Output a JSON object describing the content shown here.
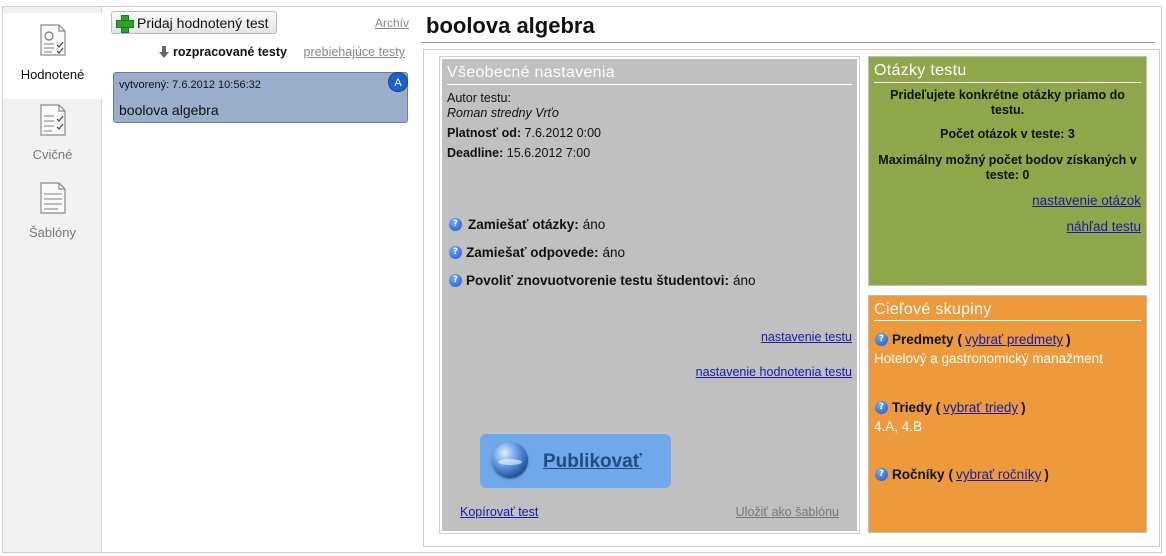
{
  "nav": {
    "items": [
      {
        "label": "Hodnotené",
        "icon": "graded-tests-icon"
      },
      {
        "label": "Cvičné",
        "icon": "practice-tests-icon"
      },
      {
        "label": "Šablóny",
        "icon": "templates-icon"
      }
    ]
  },
  "list": {
    "add_button": "Pridaj hodnotený test",
    "archive_link": "Archív",
    "filter_active": "rozpracované testy",
    "filter_other": "prebiehajúce testy",
    "card": {
      "created": "vytvorený: 7.6.2012 10:56:32",
      "title": "boolova algebra",
      "badge": "A"
    }
  },
  "main": {
    "title": "boolova algebra",
    "general": {
      "heading": "Všeobecné nastavenia",
      "author_label": "Autor testu:",
      "author_value": "Roman stredny Vrťo",
      "valid_from_label": "Platnosť od:",
      "valid_from_value": "7.6.2012 0:00",
      "deadline_label": "Deadline:",
      "deadline_value": "15.6.2012 7:00",
      "options": [
        {
          "label": "Zamiešať otázky:",
          "value": "áno"
        },
        {
          "label": "Zamiešať odpovede:",
          "value": "áno"
        },
        {
          "label": "Povoliť znovuotvorenie testu študentovi:",
          "value": "áno"
        }
      ],
      "settings_link": "nastavenie testu",
      "grading_link": "nastavenie hodnotenia testu",
      "publish_label": "Publikovať",
      "copy_link": "Kopírovať test",
      "save_template_link": "Uložiť ako šablónu"
    },
    "questions": {
      "heading": "Otázky testu",
      "info": "Prideľujete konkrétne otázky priamo do testu.",
      "count": "Počet otázok v teste: 3",
      "max_points": "Maximálny možný počet bodov získaných v teste: 0",
      "settings_link": "nastavenie otázok",
      "preview_link": "náhľad testu"
    },
    "groups": {
      "heading": "Cieľové skupiny",
      "subjects_label": "Predmety",
      "subjects_link": "vybrať predmety",
      "subjects_value": "Hotelový a gastronomický manažment",
      "classes_label": "Triedy",
      "classes_link": "vybrať triedy",
      "classes_value": "4.A, 4.B",
      "years_label": "Ročníky",
      "years_link": "vybrať ročníky",
      "paren_open": "(",
      "paren_close": ")"
    }
  },
  "colors": {
    "questions_bg": "#8fa74b",
    "groups_bg": "#ec9a3b",
    "general_bg": "#c0c0c0",
    "card_bg": "#9aaecb",
    "publish_bg": "#6fa9ea"
  }
}
